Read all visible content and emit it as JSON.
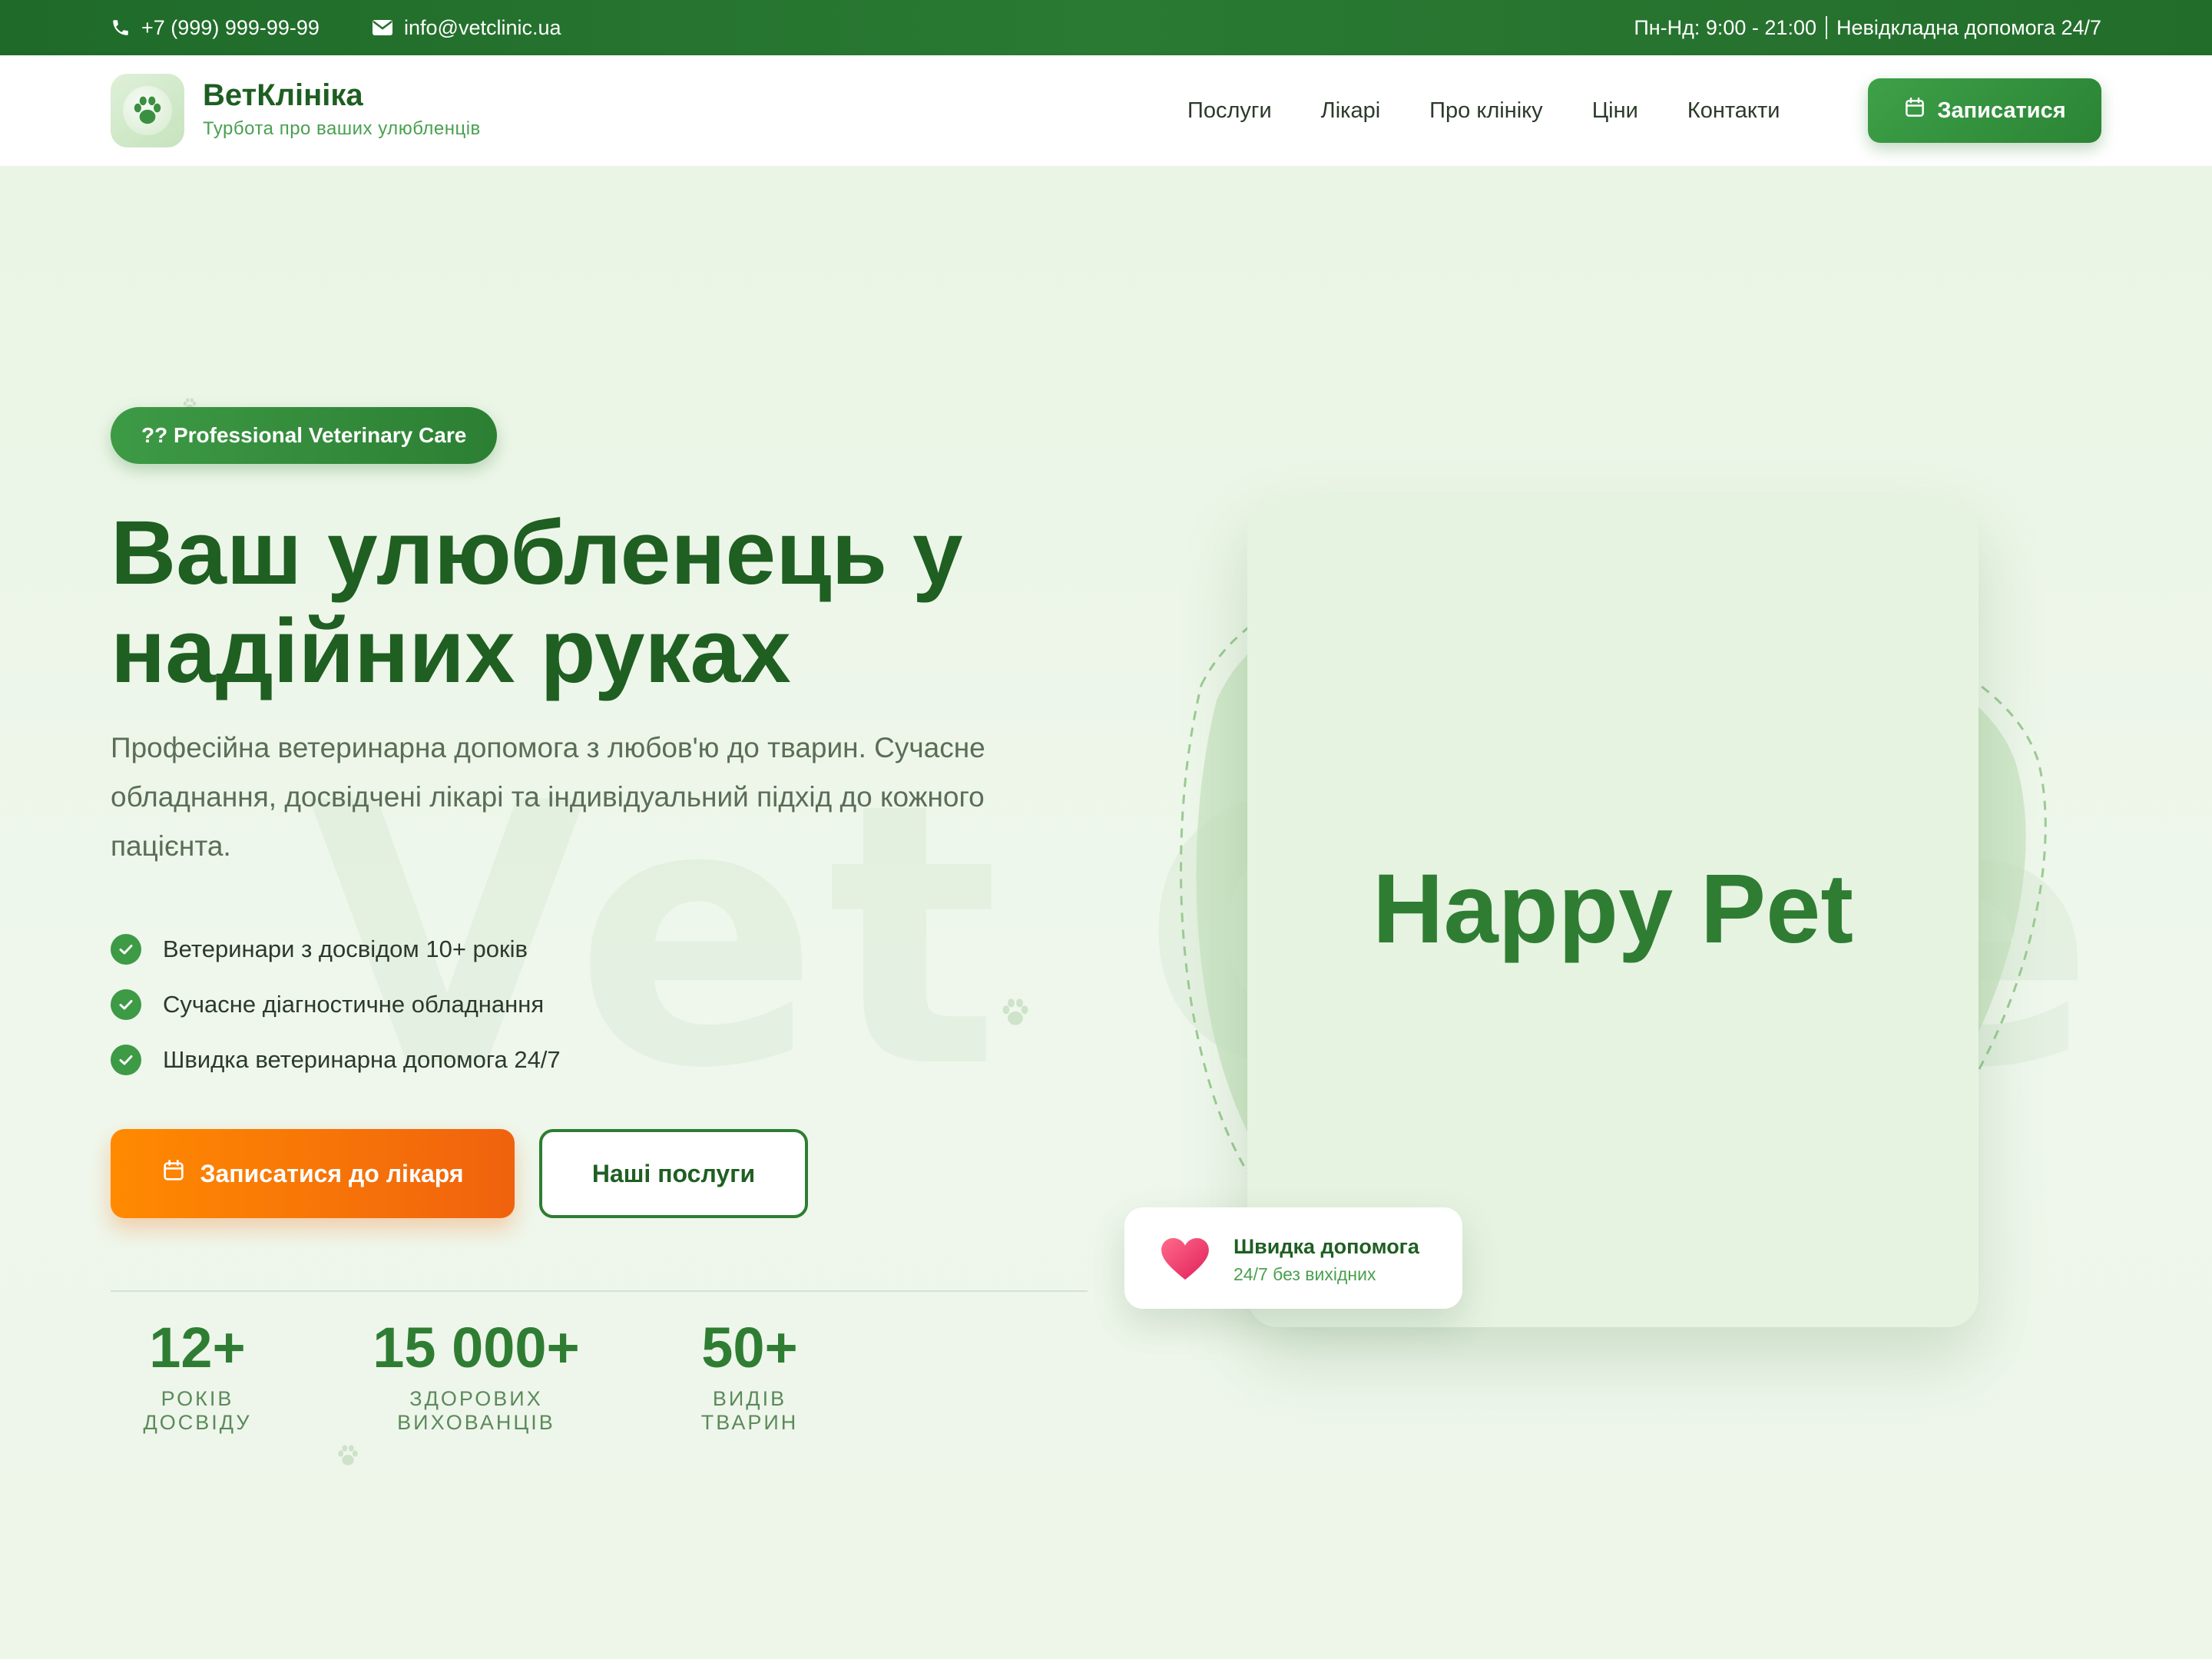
{
  "topbar": {
    "phone": "+7 (999) 999-99-99",
    "email": "info@vetclinic.ua",
    "hours": "Пн-Нд: 9:00 - 21:00",
    "emergency": "Невідкладна допомога 24/7"
  },
  "header": {
    "brand_name": "ВетКлініка",
    "brand_tagline": "Турбота про ваших улюбленців",
    "nav": [
      "Послуги",
      "Лікарі",
      "Про клініку",
      "Ціни",
      "Контакти"
    ],
    "cta_label": "Записатися"
  },
  "hero": {
    "badge": "?? Professional Veterinary Care",
    "headline_line1": "Ваш улюбленець у",
    "headline_line2": "надійних руках",
    "subtitle": "Професійна ветеринарна допомога з любов'ю до тварин. Сучасне обладнання, досвідчені лікарі та індивідуальний підхід до кожного пацієнта.",
    "watermark": "Vet Care",
    "features": [
      "Ветеринари з досвідом 10+ років",
      "Сучасне діагностичне обладнання",
      "Швидка ветеринарна допомога 24/7"
    ],
    "primary_button": "Записатися до лікаря",
    "secondary_button": "Наші послуги",
    "stats": [
      {
        "value": "12+",
        "label": "РОКІВ ДОСВІДУ"
      },
      {
        "value": "15 000+",
        "label": "ЗДОРОВИХ ВИХОВАНЦІВ"
      },
      {
        "value": "50+",
        "label": "ВИДІВ ТВАРИН"
      }
    ],
    "image_text": "Happy Pet",
    "help_card": {
      "title": "Швидка допомога",
      "subtitle": "24/7 без вихідних"
    }
  },
  "colors": {
    "brand_green": "#2e7d32",
    "dark_green": "#1f5f22",
    "accent_orange": "#f57c00",
    "background": "#eef6ea"
  },
  "icons": [
    "phone-icon",
    "mail-icon",
    "paw-icon",
    "calendar-icon",
    "check-icon",
    "heart-icon"
  ]
}
